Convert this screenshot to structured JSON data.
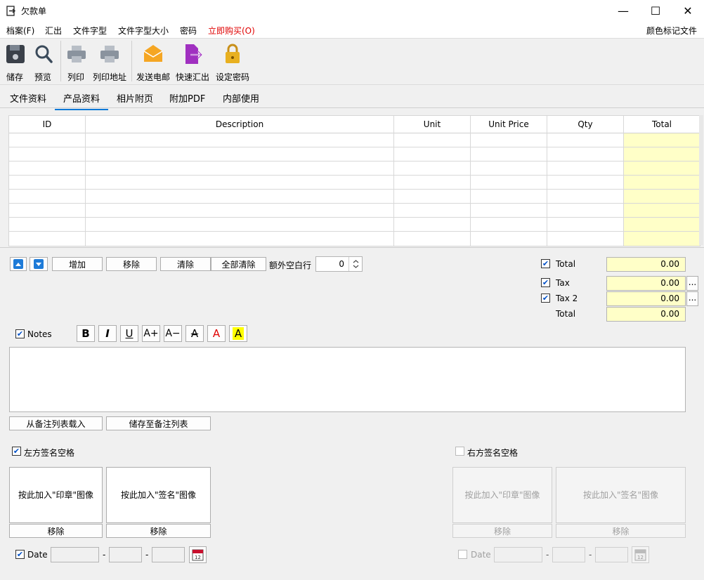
{
  "window": {
    "title": "欠款单",
    "minimize": "—",
    "maximize": "☐",
    "close": "✕"
  },
  "menu": {
    "file": "档案(F)",
    "export": "汇出",
    "font": "文件字型",
    "font_size": "文件字型大小",
    "password": "密码",
    "buy": "立即购买(O)",
    "color_mark": "颜色标记文件"
  },
  "toolbar": {
    "save": "储存",
    "preview": "预览",
    "print": "列印",
    "print_address": "列印地址",
    "send_email": "发送电邮",
    "quick_export": "快速汇出",
    "set_password": "设定密码"
  },
  "tabs": {
    "doc_info": "文件资料",
    "product_info": "产品资料",
    "photo_page": "相片附页",
    "attach_pdf": "附加PDF",
    "internal": "内部使用"
  },
  "grid": {
    "columns": [
      "ID",
      "Description",
      "Unit",
      "Unit Price",
      "Qty",
      "Total"
    ]
  },
  "controls": {
    "add": "增加",
    "remove": "移除",
    "clear": "清除",
    "clear_all": "全部清除",
    "extra_blank_rows": "额外空白行",
    "extra_blank_value": "0"
  },
  "totals": {
    "total_label": "Total",
    "total_value": "0.00",
    "tax_label": "Tax",
    "tax_value": "0.00",
    "tax2_label": "Tax 2",
    "tax2_value": "0.00",
    "grand_label": "Total",
    "grand_value": "0.00",
    "more": "..."
  },
  "notes": {
    "label": "Notes",
    "load_from_list": "从备注列表载入",
    "save_to_list": "储存至备注列表"
  },
  "format": {
    "bold": "B",
    "italic": "I",
    "underline": "U",
    "grow": "A+",
    "shrink": "A−",
    "strike": "A",
    "color": "A",
    "highlight": "A"
  },
  "signature": {
    "left_label": "左方签名空格",
    "right_label": "右方签名空格",
    "stamp_btn": "按此加入\"印章\"图像",
    "sign_btn": "按此加入\"签名\"图像",
    "remove": "移除",
    "date_label": "Date",
    "date_sep": "-",
    "cal_day": "12"
  },
  "colors": {
    "accent": "#0078d7",
    "highlight_field": "#ffffc8",
    "buy_red": "#e00000",
    "email_orange": "#f5a623",
    "export_purple": "#a030c0",
    "lock_gold": "#e8b020"
  }
}
